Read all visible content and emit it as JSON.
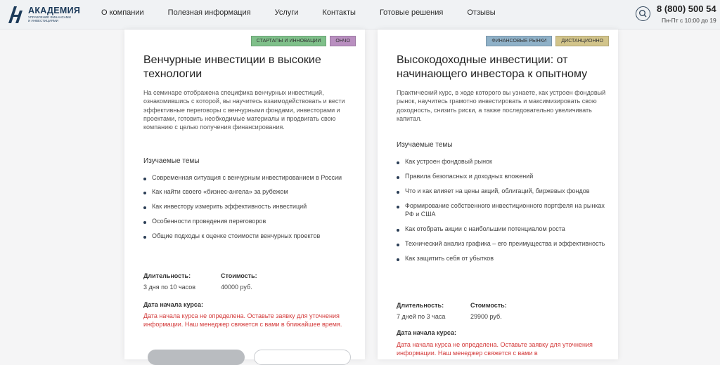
{
  "header": {
    "logo_title": "АКАДЕМИЯ",
    "logo_sub_1": "управление финансами",
    "logo_sub_2": "и инвестициями",
    "nav": [
      "О компании",
      "Полезная информация",
      "Услуги",
      "Контакты",
      "Готовые решения",
      "Отзывы"
    ],
    "phone": "8 (800) 500 54",
    "hours": "Пн-Пт с 10:00 до 19"
  },
  "cards": [
    {
      "tags": [
        {
          "label": "СТАРТАПЫ И ИННОВАЦИИ",
          "color": "#7fc08a"
        },
        {
          "label": "ОНЧО",
          "color": "#b98fc0"
        }
      ],
      "title": "Венчурные инвестиции в высокие технологии",
      "description": "На семинаре отображена специфика венчурных инвестиций, ознакомившись с которой, вы научитесь взаимодействовать и вести эффективные переговоры с венчурными фондами, инвесторами и проектами, готовить необходимые материалы и продвигать свою компанию с целью получения финансирования.",
      "topics_heading": "Изучаемые темы",
      "topics": [
        "Современная ситуация с венчурным инвестированием в России",
        "Как найти своего «бизнес-ангела» за рубежом",
        "Как инвестору измерить эффективность инвестиций",
        "Особенности проведения переговоров",
        "Общие подходы к оценке стоимости венчурных проектов"
      ],
      "duration_label": "Длительность:",
      "duration": "3 дня по 10 часов",
      "price_label": "Стоимость:",
      "price": "40000 руб.",
      "start_label": "Дата начала курса:",
      "start_note": "Дата начала курса не определена. Оставьте заявку для уточнения информации. Наш менеджер свяжется с вами в ближайшее время."
    },
    {
      "tags": [
        {
          "label": "ФИНАНСОВЫЕ РЫНКИ",
          "color": "#8fb1c8"
        },
        {
          "label": "ДИСТАНЦИОННО",
          "color": "#d2c48a"
        }
      ],
      "title": "Высокодоходные инвестиции: от начинающего инвестора к опытному",
      "description": "Практический курс, в ходе которого вы узнаете, как устроен фондовый рынок, научитесь грамотно инвестировать и максимизировать свою доходность, снизить риски, а также последовательно увеличивать капитал.",
      "topics_heading": "Изучаемые темы",
      "topics": [
        "Как устроен фондовый рынок",
        "Правила безопасных и доходных вложений",
        "Что и как влияет на цены акций, облигаций, биржевых фондов",
        "Формирование собственного инвестиционного портфеля на рынках РФ и США",
        "Как отобрать акции с наибольшим потенциалом роста",
        "Технический анализ графика – его преимущества и эффективность",
        "Как защитить себя от убытков"
      ],
      "duration_label": "Длительность:",
      "duration": "7 дней по 3 часа",
      "price_label": "Стоимость:",
      "price": "29900 руб.",
      "start_label": "Дата начала курса:",
      "start_note": "Дата начала курса не определена. Оставьте заявку для уточнения информации. Наш менеджер свяжется с вами в"
    }
  ]
}
